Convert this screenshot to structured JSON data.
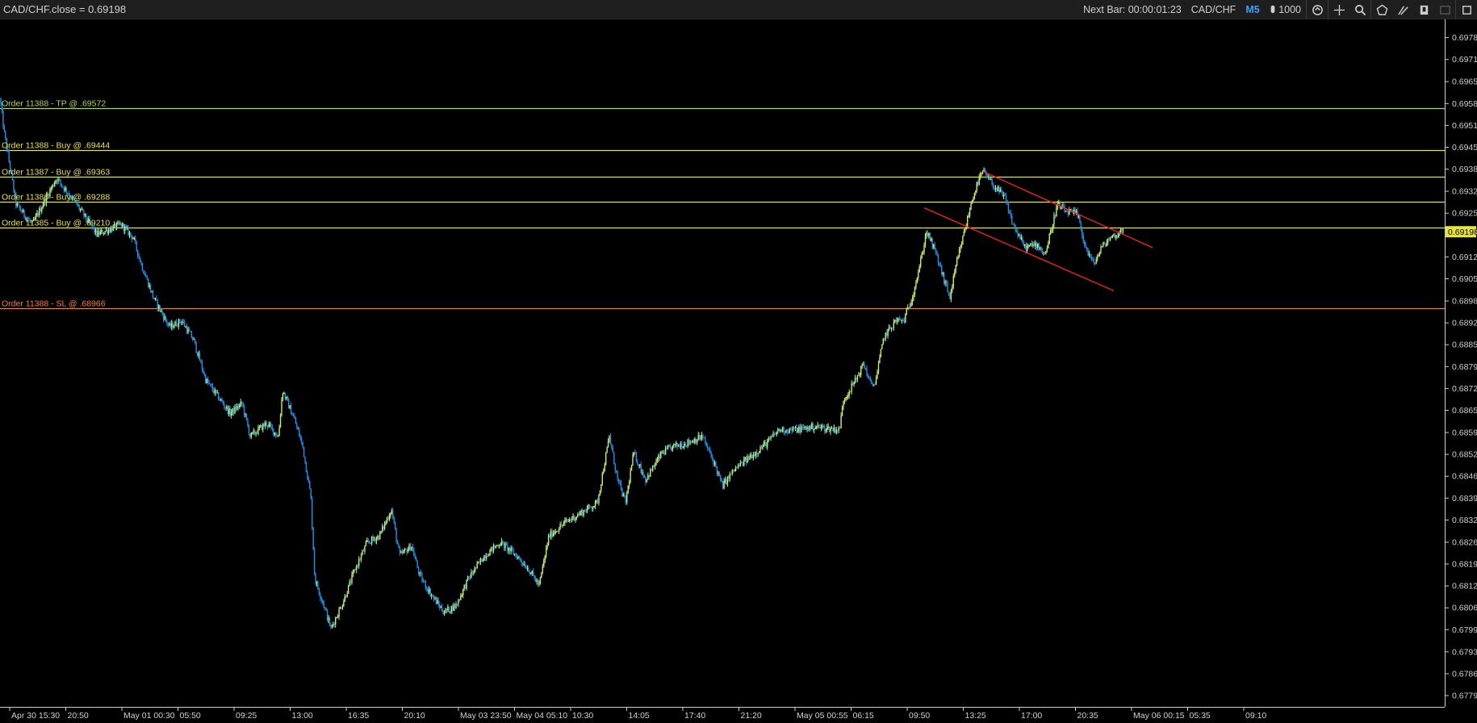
{
  "header": {
    "title": "CAD/CHF.close = 0.69198",
    "next_bar_label": "Next Bar: 00:00:01:23",
    "symbol": "CAD/CHF",
    "timeframe": "M5",
    "quantity": "1000",
    "toolbar_icons": [
      "sync-icon",
      "crosshair-icon",
      "zoom-icon",
      "pentagon-icon",
      "draw-lines-icon",
      "bookmark-icon",
      "disabled-icon",
      "settings-icon"
    ]
  },
  "colors": {
    "background": "#000000",
    "axis": "#cfcfcf",
    "bull_candle": "#c6ee6a",
    "bear_candle": "#1f8fe8",
    "tp_line": "#a8d948",
    "order_line": "#e8e23c",
    "sl_line": "#ff7a2e",
    "trendline": "#ff2020",
    "current_price_bg": "#e8e23c"
  },
  "chart_data": {
    "type": "candlestick",
    "symbol": "CAD/CHF",
    "timeframe": "M5",
    "ylim": [
      0.67764,
      0.69839
    ],
    "y_ticks": [
      "0.69784",
      "0.69718",
      "0.69651",
      "0.69585",
      "0.69519",
      "0.69453",
      "0.69387",
      "0.69320",
      "0.69254",
      "0.69198",
      "0.69122",
      "0.69056",
      "0.68989",
      "0.68923",
      "0.68857",
      "0.68791",
      "0.68725",
      "0.68659",
      "0.68592",
      "0.68526",
      "0.68460",
      "0.68394",
      "0.68328",
      "0.68261",
      "0.68195",
      "0.68129",
      "0.68063",
      "0.67997",
      "0.67930",
      "0.67864",
      "0.67798"
    ],
    "x_ticks": [
      "Apr 30 15:30",
      "20:50",
      "May 01 00:30",
      "05:50",
      "09:25",
      "13:00",
      "16:35",
      "20:10",
      "May 03 23:50",
      "May 04 05:10",
      "10:30",
      "14:05",
      "17:40",
      "21:20",
      "May 05 00:55",
      "06:15",
      "09:50",
      "13:25",
      "17:00",
      "20:35",
      "May 06 00:15",
      "05:35",
      "09:10"
    ],
    "current_price": "0.69198",
    "price_path": [
      [
        0,
        0.696
      ],
      [
        5,
        0.695
      ],
      [
        20,
        0.6928
      ],
      [
        40,
        0.6922
      ],
      [
        70,
        0.6936
      ],
      [
        95,
        0.6928
      ],
      [
        120,
        0.6919
      ],
      [
        150,
        0.6922
      ],
      [
        165,
        0.6918
      ],
      [
        175,
        0.691
      ],
      [
        190,
        0.69
      ],
      [
        210,
        0.6891
      ],
      [
        225,
        0.6893
      ],
      [
        240,
        0.6887
      ],
      [
        255,
        0.6875
      ],
      [
        270,
        0.687
      ],
      [
        285,
        0.6865
      ],
      [
        300,
        0.6868
      ],
      [
        310,
        0.6858
      ],
      [
        330,
        0.6862
      ],
      [
        345,
        0.6858
      ],
      [
        350,
        0.6872
      ],
      [
        365,
        0.6863
      ],
      [
        375,
        0.6855
      ],
      [
        385,
        0.684
      ],
      [
        390,
        0.6815
      ],
      [
        400,
        0.6808
      ],
      [
        410,
        0.68
      ],
      [
        425,
        0.6808
      ],
      [
        440,
        0.6818
      ],
      [
        455,
        0.6826
      ],
      [
        470,
        0.6828
      ],
      [
        485,
        0.6836
      ],
      [
        495,
        0.6822
      ],
      [
        510,
        0.6825
      ],
      [
        520,
        0.6816
      ],
      [
        535,
        0.681
      ],
      [
        550,
        0.6805
      ],
      [
        565,
        0.6807
      ],
      [
        580,
        0.6815
      ],
      [
        600,
        0.6822
      ],
      [
        620,
        0.6826
      ],
      [
        640,
        0.6822
      ],
      [
        655,
        0.6818
      ],
      [
        668,
        0.6813
      ],
      [
        680,
        0.6828
      ],
      [
        700,
        0.6832
      ],
      [
        720,
        0.6835
      ],
      [
        740,
        0.6838
      ],
      [
        755,
        0.6858
      ],
      [
        765,
        0.6845
      ],
      [
        775,
        0.6838
      ],
      [
        785,
        0.6853
      ],
      [
        800,
        0.6845
      ],
      [
        820,
        0.6853
      ],
      [
        835,
        0.6855
      ],
      [
        850,
        0.6856
      ],
      [
        870,
        0.6858
      ],
      [
        885,
        0.685
      ],
      [
        895,
        0.6843
      ],
      [
        910,
        0.6848
      ],
      [
        930,
        0.6852
      ],
      [
        950,
        0.6856
      ],
      [
        965,
        0.686
      ],
      [
        985,
        0.686
      ],
      [
        1010,
        0.6861
      ],
      [
        1040,
        0.686
      ],
      [
        1045,
        0.6869
      ],
      [
        1060,
        0.6875
      ],
      [
        1070,
        0.688
      ],
      [
        1080,
        0.6873
      ],
      [
        1085,
        0.6875
      ],
      [
        1095,
        0.6888
      ],
      [
        1110,
        0.6893
      ],
      [
        1120,
        0.6893
      ],
      [
        1130,
        0.69
      ],
      [
        1140,
        0.691
      ],
      [
        1148,
        0.692
      ],
      [
        1160,
        0.6913
      ],
      [
        1170,
        0.6905
      ],
      [
        1177,
        0.69
      ],
      [
        1185,
        0.691
      ],
      [
        1195,
        0.692
      ],
      [
        1205,
        0.693
      ],
      [
        1212,
        0.6935
      ],
      [
        1218,
        0.6938
      ],
      [
        1230,
        0.6934
      ],
      [
        1245,
        0.693
      ],
      [
        1255,
        0.6922
      ],
      [
        1270,
        0.6915
      ],
      [
        1285,
        0.6916
      ],
      [
        1295,
        0.6913
      ],
      [
        1300,
        0.6918
      ],
      [
        1310,
        0.6928
      ],
      [
        1320,
        0.6926
      ],
      [
        1335,
        0.6925
      ],
      [
        1345,
        0.6915
      ],
      [
        1355,
        0.691
      ],
      [
        1365,
        0.6915
      ],
      [
        1375,
        0.6918
      ],
      [
        1385,
        0.6919
      ],
      [
        1392,
        0.6921
      ]
    ],
    "levels": [
      {
        "label": "Order 11388 - TP @ .69572",
        "price": 0.69572,
        "kind": "tp"
      },
      {
        "label": "Order 11388 - Buy @ .69444",
        "price": 0.69444,
        "kind": "buy"
      },
      {
        "label": "Order 11387 - Buy @ .69363",
        "price": 0.69363,
        "kind": "buy"
      },
      {
        "label": "Order 11386 - Buy @ .69288",
        "price": 0.69288,
        "kind": "buy"
      },
      {
        "label": "Order 11385 - Buy @ .69210",
        "price": 0.6921,
        "kind": "buy"
      },
      {
        "label": "Order 11388 - SL @ .68966",
        "price": 0.68966,
        "kind": "sl"
      }
    ],
    "trendlines": [
      {
        "name": "upper",
        "from": [
          1218,
          0.6938
        ],
        "to": [
          1428,
          0.6915
        ]
      },
      {
        "name": "lower",
        "from": [
          1145,
          0.6927
        ],
        "to": [
          1380,
          0.6902
        ]
      }
    ]
  }
}
